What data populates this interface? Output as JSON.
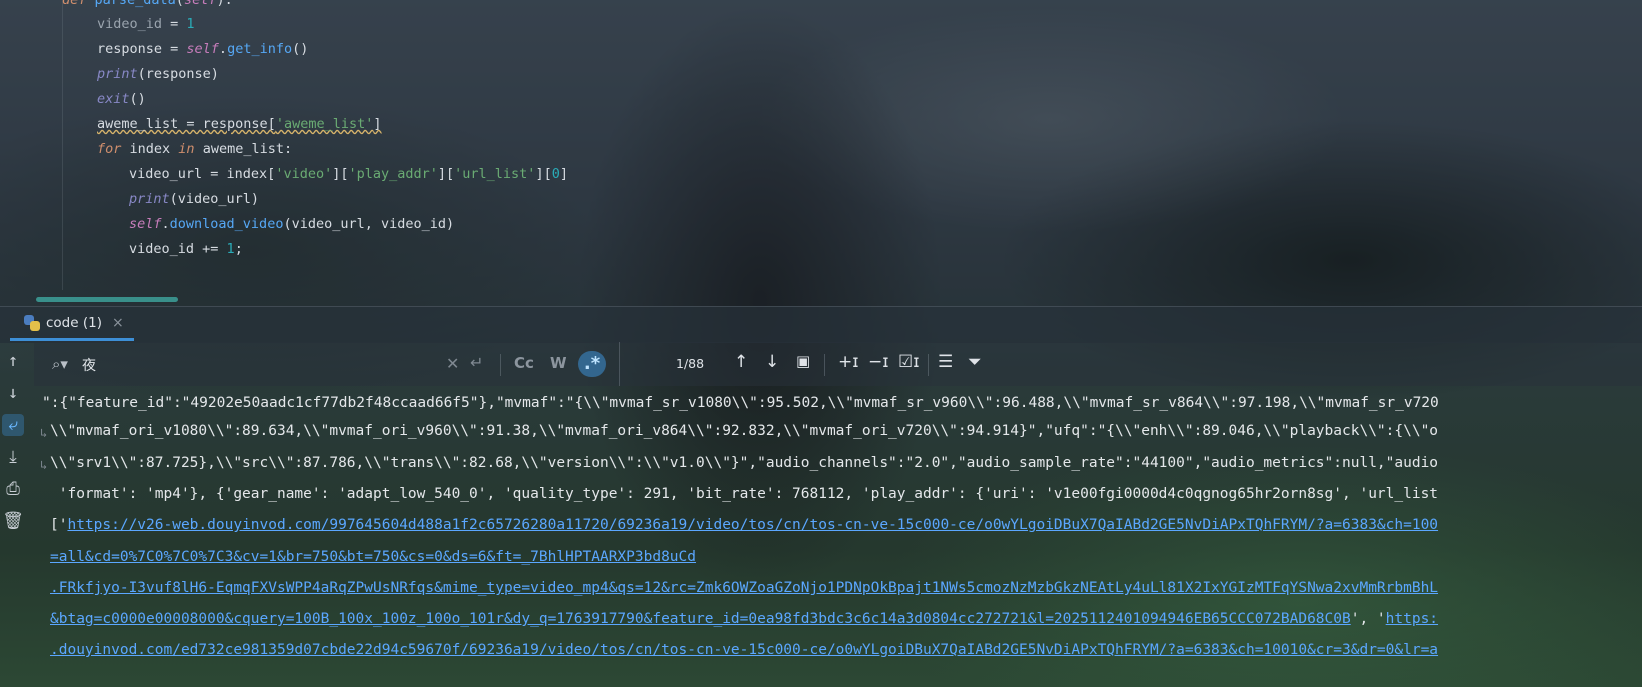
{
  "editor": {
    "lines": [
      {
        "id": "def",
        "tokens": [
          {
            "t": "def ",
            "c": "kw"
          },
          {
            "t": "parse_data",
            "c": "fn"
          },
          {
            "t": "(",
            "c": ""
          },
          {
            "t": "self",
            "c": "self"
          },
          {
            "t": "):",
            "c": ""
          }
        ]
      },
      {
        "id": "l1",
        "tokens": [
          {
            "t": "video_id",
            "c": "dim"
          },
          {
            "t": " = ",
            "c": ""
          },
          {
            "t": "1",
            "c": "num"
          }
        ]
      },
      {
        "id": "l2",
        "tokens": [
          {
            "t": "response = ",
            "c": ""
          },
          {
            "t": "self",
            "c": "self"
          },
          {
            "t": ".",
            "c": ""
          },
          {
            "t": "get_info",
            "c": "fn"
          },
          {
            "t": "()",
            "c": ""
          }
        ]
      },
      {
        "id": "l3",
        "tokens": [
          {
            "t": "print",
            "c": "bi"
          },
          {
            "t": "(response)",
            "c": ""
          }
        ]
      },
      {
        "id": "l4",
        "tokens": [
          {
            "t": "exit",
            "c": "bi"
          },
          {
            "t": "()",
            "c": ""
          }
        ]
      },
      {
        "id": "l5",
        "tokens": [
          {
            "t": "aweme_list = response[",
            "c": "warn"
          },
          {
            "t": "'aweme_list'",
            "c": "str warn"
          },
          {
            "t": "]",
            "c": "warn"
          }
        ]
      },
      {
        "id": "l6",
        "tokens": [
          {
            "t": "for",
            "c": "kw"
          },
          {
            "t": " index ",
            "c": ""
          },
          {
            "t": "in",
            "c": "kw"
          },
          {
            "t": " aweme_list:",
            "c": ""
          }
        ]
      },
      {
        "id": "l7",
        "tokens": [
          {
            "t": "video_url = index[",
            "c": ""
          },
          {
            "t": "'video'",
            "c": "str"
          },
          {
            "t": "][",
            "c": ""
          },
          {
            "t": "'play_addr'",
            "c": "str"
          },
          {
            "t": "][",
            "c": ""
          },
          {
            "t": "'url_list'",
            "c": "str"
          },
          {
            "t": "][",
            "c": ""
          },
          {
            "t": "0",
            "c": "num"
          },
          {
            "t": "]",
            "c": ""
          }
        ]
      },
      {
        "id": "l8",
        "tokens": [
          {
            "t": "print",
            "c": "bi"
          },
          {
            "t": "(video_url)",
            "c": ""
          }
        ]
      },
      {
        "id": "l9",
        "tokens": [
          {
            "t": "self",
            "c": "self"
          },
          {
            "t": ".",
            "c": ""
          },
          {
            "t": "download_video",
            "c": "fn"
          },
          {
            "t": "(video_url, video_id)",
            "c": ""
          }
        ]
      },
      {
        "id": "l10",
        "tokens": [
          {
            "t": "video_id += ",
            "c": ""
          },
          {
            "t": "1",
            "c": "num"
          },
          {
            "t": ";",
            "c": ""
          }
        ]
      }
    ]
  },
  "run_panel": {
    "tab_label": "code (1)",
    "tab_close": "×"
  },
  "find": {
    "query": "夜",
    "option_case": "Cc",
    "option_word": "W",
    "option_regex": ".*",
    "match_count": "1/88"
  },
  "console": {
    "lines": [
      {
        "segs": [
          {
            "t": "\":{\"feature_id\":\"49202e50aadc1cf77db2f48ccaad66f5\"},\"mvmaf\":\"{\\\\\"mvmaf_sr_v1080\\\\\":95.502,\\\\\"mvmaf_sr_v960\\\\\":96.488,\\\\\"mvmaf_sr_v864\\\\\":97.198,\\\\\"mvmaf_sr_v720",
            "l": false
          }
        ]
      },
      {
        "segs": [
          {
            "t": "\\\\\"mvmaf_ori_v1080\\\\\":89.634,\\\\\"mvmaf_ori_v960\\\\\":91.38,\\\\\"mvmaf_ori_v864\\\\\":92.832,\\\\\"mvmaf_ori_v720\\\\\":94.914}\",\"ufq\":\"{\\\\\"enh\\\\\":89.046,\\\\\"playback\\\\\":{\\\\\"o",
            "l": false
          }
        ]
      },
      {
        "segs": [
          {
            "t": "\\\\\"srv1\\\\\":87.725},\\\\\"src\\\\\":87.786,\\\\\"trans\\\\\":82.68,\\\\\"version\\\\\":\\\\\"v1.0\\\\\"}\",\"audio_channels\":\"2.0\",\"audio_sample_rate\":\"44100\",\"audio_metrics\":null,\"audio",
            "l": false
          }
        ]
      },
      {
        "segs": [
          {
            "t": " 'format': 'mp4'}, {'gear_name': 'adapt_low_540_0', 'quality_type': 291, 'bit_rate': 768112, 'play_addr': {'uri': 'v1e00fgi0000d4c0qgnog65hr2orn8sg', 'url_list",
            "l": false
          }
        ]
      },
      {
        "segs": [
          {
            "t": "['",
            "l": false
          },
          {
            "t": "https://v26-web.douyinvod.com/997645604d488a1f2c65726280a11720/69236a19/video/tos/cn/tos-cn-ve-15c000-ce/o0wYLgoiDBuX7QaIABd2GE5NvDiAPxTQhFRYM/?a=6383&ch=100",
            "l": true
          }
        ]
      },
      {
        "segs": [
          {
            "t": "=all&cd=0%7C0%7C0%7C3&cv=1&br=750&bt=750&cs=0&ds=6&ft=_7BhlHPTAARXP3bd8uCd",
            "l": true
          }
        ]
      },
      {
        "segs": [
          {
            "t": ".FRkfjyo-I3vuf8lH6-EqmqFXVsWPP4aRqZPwUsNRfqs&mime_type=video_mp4&qs=12&rc=Zmk6OWZoaGZoNjo1PDNpOkBpajt1NWs5cmozNzMzbGkzNEAtLy4uLl81X2IxYGIzMTFqYSNwa2xvMmRrbmBhL",
            "l": true
          }
        ]
      },
      {
        "segs": [
          {
            "t": "&btag=c0000e00008000&cquery=100B_100x_100z_100o_101r&dy_q=1763917790&feature_id=0ea98fd3bdc3c6c14a3d0804cc272721&l=2025112401094946EB65CCC072BAD68C0B",
            "l": true
          },
          {
            "t": "', '",
            "l": false
          },
          {
            "t": "https:",
            "l": true
          }
        ]
      },
      {
        "segs": [
          {
            "t": ".douyinvod.com/ed732ce981359d07cbde22d94c59670f/69236a19/video/tos/cn/tos-cn-ve-15c000-ce/o0wYLgoiDBuX7QaIABd2GE5NvDiAPxTQhFRYM/?a=6383&ch=10010&cr=3&dr=0&lr=a",
            "l": true
          }
        ]
      }
    ]
  }
}
